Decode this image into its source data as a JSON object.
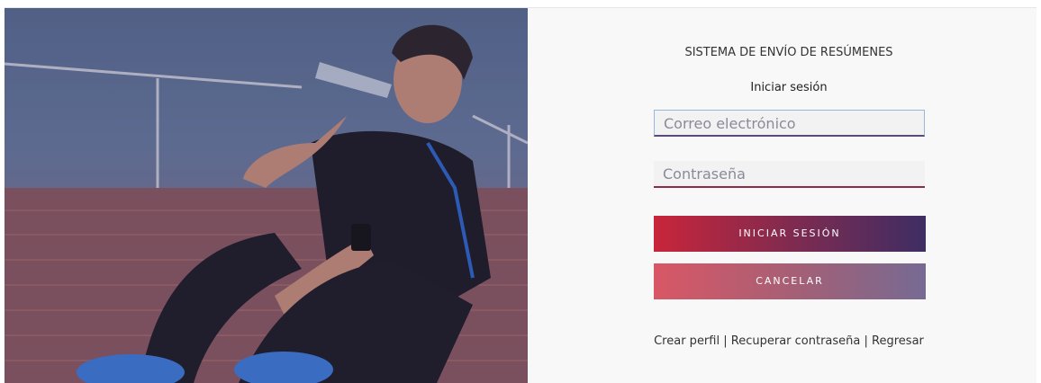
{
  "panel": {
    "title": "SISTEMA DE ENVÍO DE RESÚMENES",
    "subtitle": "Iniciar sesión"
  },
  "form": {
    "email_placeholder": "Correo electrónico",
    "password_placeholder": "Contraseña"
  },
  "buttons": {
    "login_label": "INICIAR SESIÓN",
    "cancel_label": "CANCELAR"
  },
  "links": {
    "create_profile": "Crear perfil",
    "recover_password": "Recuperar contraseña",
    "back": "Regresar",
    "separator": "|"
  },
  "colors": {
    "login_start": "#c8253a",
    "login_end": "#3e2d63",
    "cancel_start": "#d95765",
    "cancel_end": "#766a93"
  }
}
